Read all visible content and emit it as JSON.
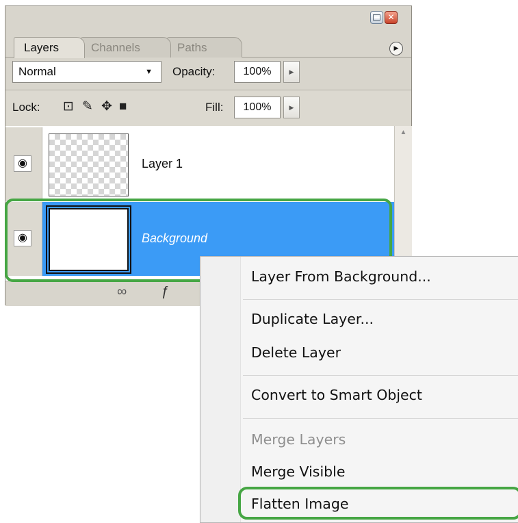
{
  "panel": {
    "tabs": [
      "Layers",
      "Channels",
      "Paths"
    ],
    "blend_mode": "Normal",
    "opacity_label": "Opacity:",
    "opacity_value": "100%",
    "lock_label": "Lock:",
    "fill_label": "Fill:",
    "fill_value": "100%",
    "layers": [
      {
        "name": "Layer 1",
        "selected": false
      },
      {
        "name": "Background",
        "selected": true
      }
    ]
  },
  "context_menu": {
    "items": [
      {
        "label": "Layer From Background...",
        "enabled": true
      },
      {
        "label": "Duplicate Layer...",
        "enabled": true
      },
      {
        "label": "Delete Layer",
        "enabled": true
      },
      {
        "label": "Convert to Smart Object",
        "enabled": true
      },
      {
        "label": "Merge Layers",
        "enabled": false
      },
      {
        "label": "Merge Visible",
        "enabled": true
      },
      {
        "label": "Flatten Image",
        "enabled": true,
        "highlighted": true
      }
    ]
  },
  "colors": {
    "selection": "#3b9bf6",
    "highlight_outline": "#46a644",
    "panel_bg": "#d8d5cc"
  }
}
